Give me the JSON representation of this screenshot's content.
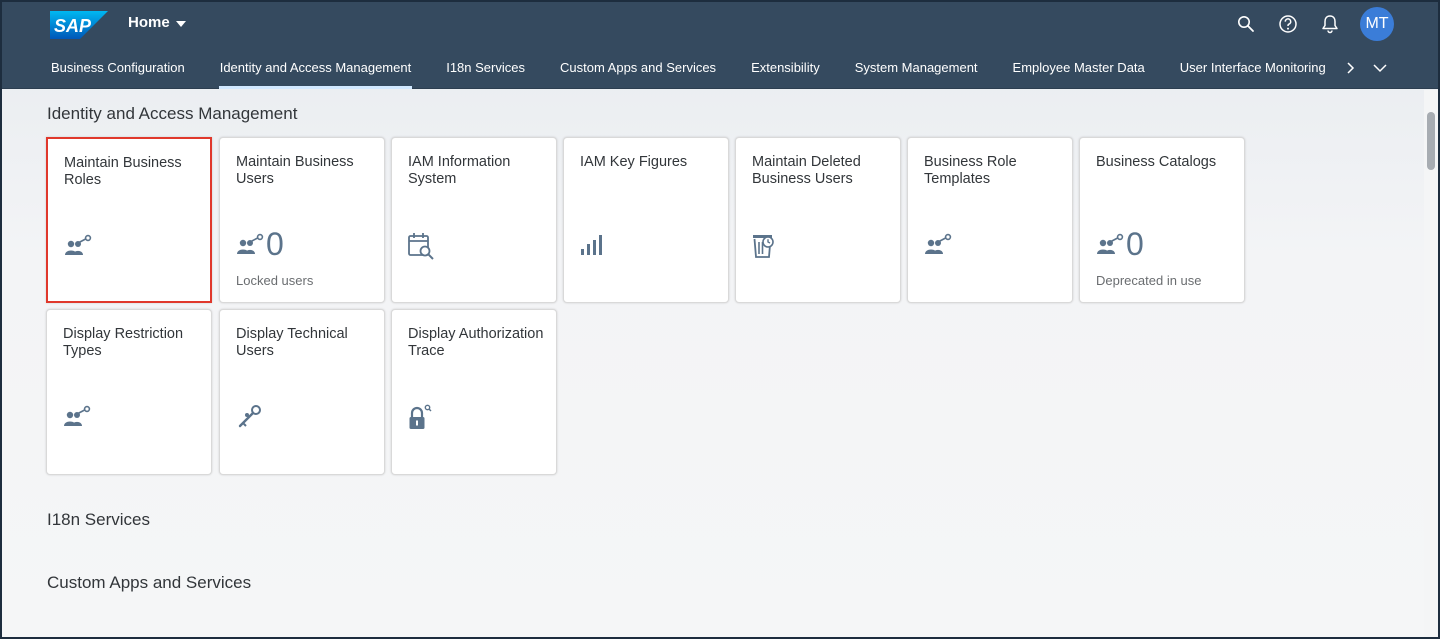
{
  "shell": {
    "logo_text": "SAP",
    "home_label": "Home",
    "avatar_initials": "MT",
    "icons": [
      "search-icon",
      "help-icon",
      "notification-bell-icon"
    ]
  },
  "tabs": [
    {
      "label": "Business Configuration",
      "active": false
    },
    {
      "label": "Identity and Access Management",
      "active": true
    },
    {
      "label": "I18n Services",
      "active": false
    },
    {
      "label": "Custom Apps and Services",
      "active": false
    },
    {
      "label": "Extensibility",
      "active": false
    },
    {
      "label": "System Management",
      "active": false
    },
    {
      "label": "Employee Master Data",
      "active": false
    },
    {
      "label": "User Interface Monitoring",
      "active": false
    }
  ],
  "sections": {
    "iam": {
      "title": "Identity and Access Management",
      "tiles": [
        {
          "title": "Maintain Business Roles",
          "icon": "role-key-icon",
          "selected": true
        },
        {
          "title": "Maintain Business Users",
          "icon": "role-key-icon",
          "number": "0",
          "footer": "Locked users"
        },
        {
          "title": "IAM Information System",
          "icon": "calendar-search-icon"
        },
        {
          "title": "IAM Key Figures",
          "icon": "bar-chart-icon"
        },
        {
          "title": "Maintain Deleted Business Users",
          "icon": "trash-clock-icon"
        },
        {
          "title": "Business Role Templates",
          "icon": "role-key-icon"
        },
        {
          "title": "Business Catalogs",
          "icon": "role-key-icon",
          "number": "0",
          "footer": "Deprecated in use"
        },
        {
          "title": "Display Restriction Types",
          "icon": "role-key-icon"
        },
        {
          "title": "Display Technical Users",
          "icon": "key-wrench-icon"
        },
        {
          "title": "Display Authorization Trace",
          "icon": "lock-search-icon"
        }
      ]
    },
    "i18n": {
      "title": "I18n Services"
    },
    "custom": {
      "title": "Custom Apps and Services"
    }
  },
  "colors": {
    "shell_bg": "#354a5f",
    "accent": "#3b7dd8",
    "icon": "#5b738b",
    "selected_border": "#e0382c"
  }
}
